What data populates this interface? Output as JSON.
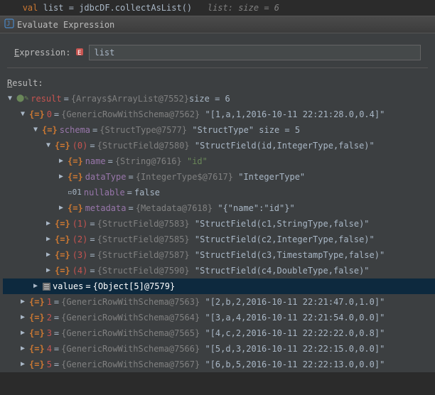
{
  "editor": {
    "keyword": "val",
    "varname": "list",
    "eq": " = ",
    "call": "jdbcDF.collectAsList()",
    "hint": "list:  size = 6"
  },
  "titlebar": {
    "title": "Evaluate Expression"
  },
  "expression": {
    "label": "Expression:",
    "value": "list"
  },
  "resultLabel": "Result:",
  "tree": {
    "result": {
      "name": "result",
      "eq": " = ",
      "type": "{Arrays$ArrayList@7552}",
      "suffix": " size = 6"
    },
    "row0": {
      "name": "0",
      "type": "{GenericRowWithSchema@7562}",
      "value": "\"[1,a,1,2016-10-11 22:21:28.0,0.4]\""
    },
    "schema": {
      "name": "schema",
      "type": "{StructType@7577}",
      "value": "\"StructType\" size = 5"
    },
    "f0": {
      "name": "(0)",
      "type": "{StructField@7580}",
      "value": "\"StructField(id,IntegerType,false)\""
    },
    "f0name": {
      "name": "name",
      "type": "{String@7616}",
      "value": "\"id\""
    },
    "f0datatype": {
      "name": "dataType",
      "type": "{IntegerType$@7617}",
      "value": "\"IntegerType\""
    },
    "f0nullable": {
      "name": "nullable",
      "value": "false"
    },
    "f0meta": {
      "name": "metadata",
      "type": "{Metadata@7618}",
      "value": "\"{\"name\":\"id\"}\""
    },
    "f1": {
      "name": "(1)",
      "type": "{StructField@7583}",
      "value": "\"StructField(c1,StringType,false)\""
    },
    "f2": {
      "name": "(2)",
      "type": "{StructField@7585}",
      "value": "\"StructField(c2,IntegerType,false)\""
    },
    "f3": {
      "name": "(3)",
      "type": "{StructField@7587}",
      "value": "\"StructField(c3,TimestampType,false)\""
    },
    "f4": {
      "name": "(4)",
      "type": "{StructField@7590}",
      "value": "\"StructField(c4,DoubleType,false)\""
    },
    "values": {
      "name": "values",
      "type": "{Object[5]@7579}"
    },
    "row1": {
      "name": "1",
      "type": "{GenericRowWithSchema@7563}",
      "value": "\"[2,b,2,2016-10-11 22:21:47.0,1.0]\""
    },
    "row2": {
      "name": "2",
      "type": "{GenericRowWithSchema@7564}",
      "value": "\"[3,a,4,2016-10-11 22:21:54.0,0.0]\""
    },
    "row3": {
      "name": "3",
      "type": "{GenericRowWithSchema@7565}",
      "value": "\"[4,c,2,2016-10-11 22:22:22.0,0.8]\""
    },
    "row4": {
      "name": "4",
      "type": "{GenericRowWithSchema@7566}",
      "value": "\"[5,d,3,2016-10-11 22:22:15.0,0.0]\""
    },
    "row5": {
      "name": "5",
      "type": "{GenericRowWithSchema@7567}",
      "value": "\"[6,b,5,2016-10-11 22:22:13.0,0.0]\""
    }
  }
}
